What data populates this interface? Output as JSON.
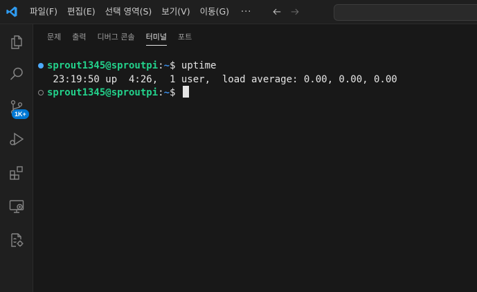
{
  "menu": {
    "items": [
      "파일(F)",
      "편집(E)",
      "선택 영역(S)",
      "보기(V)",
      "이동(G)"
    ],
    "more": "···"
  },
  "activity_bar": {
    "icons": [
      "explorer-icon",
      "search-icon",
      "source-control-icon",
      "run-debug-icon",
      "extensions-icon",
      "remote-explorer-icon",
      "docker-icon"
    ],
    "source_control_badge": "1K+"
  },
  "panel": {
    "tabs": [
      "문제",
      "출력",
      "디버그 콘솔",
      "터미널",
      "포트"
    ],
    "active_tab": "터미널"
  },
  "terminal": {
    "line1": {
      "user_host": "sprout1345@sproutpi",
      "colon": ":",
      "path": "~",
      "prompt": "$ ",
      "command": "uptime"
    },
    "line2": " 23:19:50 up  4:26,  1 user,  load average: 0.00, 0.00, 0.00",
    "line3": {
      "user_host": "sprout1345@sproutpi",
      "colon": ":",
      "path": "~",
      "prompt": "$ "
    }
  },
  "colors": {
    "accent": "#0078d4",
    "prompt_user": "#23d18b",
    "prompt_path": "#3b8eea",
    "decoration_success": "#4daafc"
  }
}
